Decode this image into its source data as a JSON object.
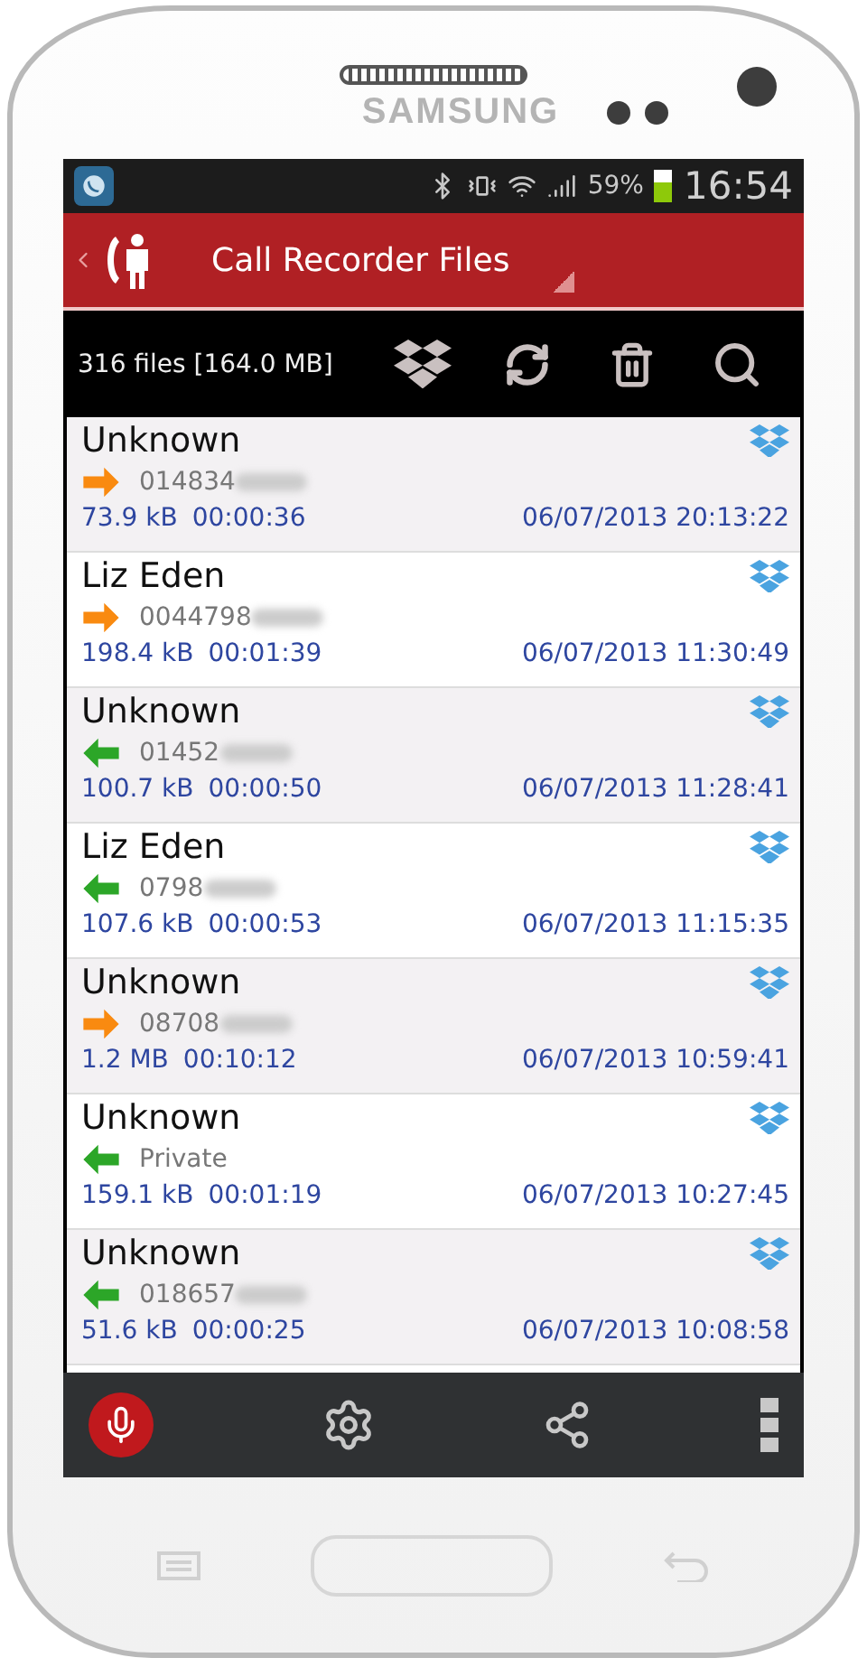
{
  "device": {
    "brand": "SAMSUNG"
  },
  "status_bar": {
    "battery": "59%",
    "time": "16:54"
  },
  "app_bar": {
    "title": "Call Recorder Files"
  },
  "toolbar": {
    "summary": "316 files [164.0 MB]"
  },
  "recordings": [
    {
      "name": "Unknown",
      "kind": "outgoing",
      "number": "014834",
      "redacted": true,
      "size": "73.9 kB",
      "duration": "00:00:36",
      "datetime": "06/07/2013 20:13:22"
    },
    {
      "name": "Liz Eden",
      "kind": "outgoing",
      "number": "0044798",
      "redacted": true,
      "size": "198.4 kB",
      "duration": "00:01:39",
      "datetime": "06/07/2013 11:30:49"
    },
    {
      "name": "Unknown",
      "kind": "incoming",
      "number": "01452",
      "redacted": true,
      "size": "100.7 kB",
      "duration": "00:00:50",
      "datetime": "06/07/2013 11:28:41"
    },
    {
      "name": "Liz Eden",
      "kind": "incoming",
      "number": "0798",
      "redacted": true,
      "size": "107.6 kB",
      "duration": "00:00:53",
      "datetime": "06/07/2013 11:15:35"
    },
    {
      "name": "Unknown",
      "kind": "outgoing",
      "number": "08708",
      "redacted": true,
      "size": "1.2 MB",
      "duration": "00:10:12",
      "datetime": "06/07/2013 10:59:41"
    },
    {
      "name": "Unknown",
      "kind": "incoming",
      "number": "Private",
      "redacted": false,
      "size": "159.1 kB",
      "duration": "00:01:19",
      "datetime": "06/07/2013 10:27:45"
    },
    {
      "name": "Unknown",
      "kind": "incoming",
      "number": "018657",
      "redacted": true,
      "size": "51.6 kB",
      "duration": "00:00:25",
      "datetime": "06/07/2013 10:08:58"
    }
  ]
}
